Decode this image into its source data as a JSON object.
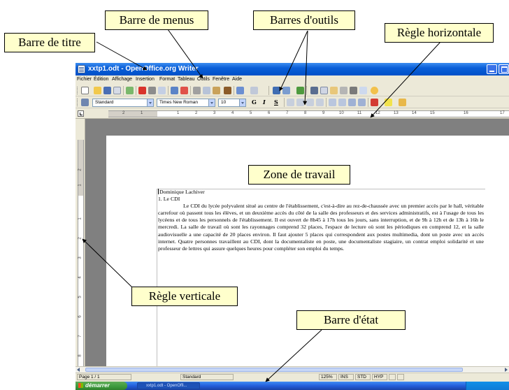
{
  "window": {
    "title": "xxtp1.odt - OpenOffice.org Writer"
  },
  "menubar": {
    "items": [
      "Fichier",
      "Édition",
      "Affichage",
      "Insertion",
      "Format",
      "Tableau",
      "Outils",
      "Fenêtre",
      "Aide"
    ]
  },
  "format_toolbar": {
    "style": "Standard",
    "font": "Times New Roman",
    "size": "10",
    "bold": "G",
    "italic": "I",
    "underline": "S"
  },
  "ruler": {
    "horizontal_labels": [
      "2",
      "1",
      "1",
      "2",
      "3",
      "4",
      "5",
      "6",
      "7",
      "8",
      "9",
      "10",
      "11",
      "12",
      "13",
      "14",
      "15",
      "16",
      "17"
    ],
    "vertical_labels": [
      "2",
      "1",
      "1",
      "2",
      "3",
      "4",
      "5",
      "6",
      "7",
      "8"
    ]
  },
  "document": {
    "author": "Dominique Lachiver",
    "heading": "1. Le CDI",
    "body": "Le CDI du lycée polyvalent situé au centre de l'établissement, c'est-à-dire au rez-de-chaussée avec un premier accès par le hall, véritable carrefour où passent tous les élèves, et un deuxième accès du côté de la salle des professeurs et des services administratifs, est à l'usage de tous les lycéens et de tous les personnels de l'établissement. Il est ouvert de 8h45 à 17h tous les jours, sans interruption, et de 9h à 12h et de 13h à 16h le mercredi. La salle de travail où sont les rayonnages comprend 32 places, l'espace de lecture où sont les périodiques en comprend 12, et la salle audiovisuelle a une capacité de 20 places environ. Il faut ajouter 5 places qui correspondent aux postes multimedia, dont un poste avec un accès internet. Quatre personnes travaillent au CDI, dont la documentaliste en poste, une documentaliste stagiaire, un contrat emploi solidarité et une professeur de lettres qui assure quelques heures pour compléter son emploi du temps."
  },
  "statusbar": {
    "page": "Page 1 / 1",
    "style": "Standard",
    "zoom": "125%",
    "ins": "INS",
    "std": "STD",
    "hyp": "HYP"
  },
  "taskbar": {
    "start": "démarrer",
    "task": "xxtp1.odt - OpenOffi..."
  },
  "annotations": {
    "title_bar": "Barre de titre",
    "menu_bar": "Barre de menus",
    "toolbars": "Barres d'outils",
    "h_ruler": "Règle horizontale",
    "work_area": "Zone de travail",
    "v_ruler": "Règle verticale",
    "status_bar": "Barre d'état"
  }
}
